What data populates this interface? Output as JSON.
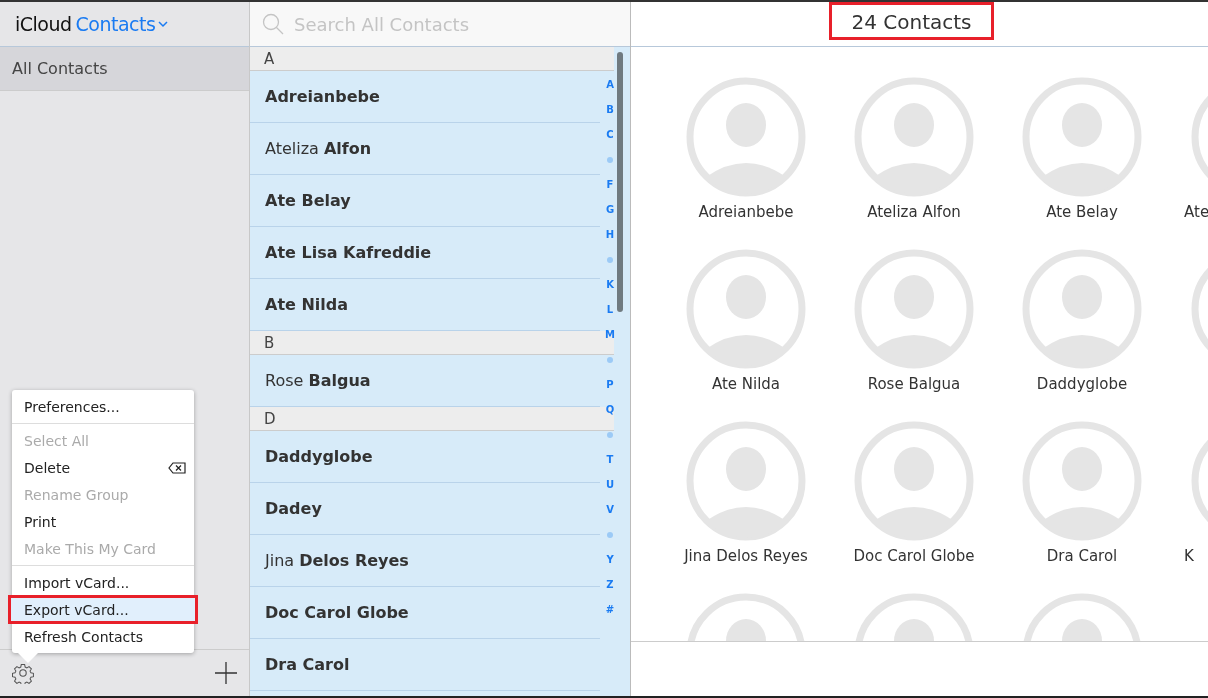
{
  "sidebar": {
    "app_title": "iCloud",
    "app_name": "Contacts",
    "groups": [
      {
        "label": "All Contacts",
        "selected": true
      }
    ]
  },
  "search": {
    "placeholder": "Search All Contacts"
  },
  "list": {
    "sections": [
      {
        "letter": "A",
        "contacts": [
          {
            "last": "Adreianbebe",
            "selected": true
          },
          {
            "first": "Ateliza",
            "last": "Alfon",
            "selected": true
          },
          {
            "last": "Ate Belay",
            "selected": true
          },
          {
            "last": "Ate Lisa Kafreddie",
            "selected": true
          },
          {
            "last": "Ate Nilda",
            "selected": true
          }
        ]
      },
      {
        "letter": "B",
        "contacts": [
          {
            "first": "Rose",
            "last": "Balgua",
            "selected": true
          }
        ]
      },
      {
        "letter": "D",
        "contacts": [
          {
            "last": "Daddyglobe",
            "selected": true
          },
          {
            "last": "Dadey",
            "selected": true
          },
          {
            "first": "Jina",
            "last": "Delos Reyes",
            "selected": true
          },
          {
            "last": "Doc Carol Globe",
            "selected": true
          },
          {
            "last": "Dra Carol",
            "selected": true
          }
        ]
      }
    ],
    "index": [
      {
        "kind": "letter",
        "label": "A"
      },
      {
        "kind": "letter",
        "label": "B"
      },
      {
        "kind": "letter",
        "label": "C"
      },
      {
        "kind": "dot"
      },
      {
        "kind": "letter",
        "label": "F"
      },
      {
        "kind": "letter",
        "label": "G"
      },
      {
        "kind": "letter",
        "label": "H"
      },
      {
        "kind": "dot"
      },
      {
        "kind": "letter",
        "label": "K"
      },
      {
        "kind": "letter",
        "label": "L"
      },
      {
        "kind": "letter",
        "label": "M"
      },
      {
        "kind": "dot"
      },
      {
        "kind": "letter",
        "label": "P"
      },
      {
        "kind": "letter",
        "label": "Q"
      },
      {
        "kind": "dot"
      },
      {
        "kind": "letter",
        "label": "T"
      },
      {
        "kind": "letter",
        "label": "U"
      },
      {
        "kind": "letter",
        "label": "V"
      },
      {
        "kind": "dot"
      },
      {
        "kind": "letter",
        "label": "Y"
      },
      {
        "kind": "letter",
        "label": "Z"
      },
      {
        "kind": "letter",
        "label": "#"
      }
    ]
  },
  "detail": {
    "count": "24 Contacts",
    "count_annotated": true,
    "cards": [
      {
        "kind": "named",
        "name": "Adreianbebe"
      },
      {
        "kind": "named",
        "name": "Ateliza Alfon"
      },
      {
        "kind": "named",
        "name": "Ate Belay"
      },
      {
        "kind": "named",
        "name": "Ate"
      },
      {
        "kind": "named",
        "name": "Ate Nilda"
      },
      {
        "kind": "named",
        "name": "Rose Balgua"
      },
      {
        "kind": "named",
        "name": "Daddyglobe"
      },
      {
        "kind": "unnamed"
      },
      {
        "kind": "named",
        "name": "Jina Delos Reyes"
      },
      {
        "kind": "named",
        "name": "Doc Carol Globe"
      },
      {
        "kind": "named",
        "name": "Dra Carol"
      },
      {
        "kind": "named",
        "name": "K"
      },
      {
        "kind": "unnamed"
      },
      {
        "kind": "unnamed"
      },
      {
        "kind": "unnamed"
      }
    ]
  },
  "menu": {
    "items": [
      {
        "kind": "item",
        "label": "Preferences...",
        "disabled": false,
        "highlighted": false,
        "annotated": false
      },
      {
        "kind": "separator"
      },
      {
        "kind": "item",
        "label": "Select All",
        "disabled": true,
        "highlighted": false,
        "annotated": false
      },
      {
        "kind": "item_with_icon",
        "label": "Delete",
        "disabled": false,
        "highlighted": false,
        "annotated": false
      },
      {
        "kind": "item",
        "label": "Rename Group",
        "disabled": true,
        "highlighted": false,
        "annotated": false
      },
      {
        "kind": "item",
        "label": "Print",
        "disabled": false,
        "highlighted": false,
        "annotated": false
      },
      {
        "kind": "item",
        "label": "Make This My Card",
        "disabled": true,
        "highlighted": false,
        "annotated": false
      },
      {
        "kind": "separator"
      },
      {
        "kind": "item",
        "label": "Import vCard...",
        "disabled": false,
        "highlighted": false,
        "annotated": false
      },
      {
        "kind": "item",
        "label": "Export vCard...",
        "disabled": false,
        "highlighted": true,
        "annotated": true
      },
      {
        "kind": "item",
        "label": "Refresh Contacts",
        "disabled": false,
        "highlighted": false,
        "annotated": false
      }
    ]
  }
}
